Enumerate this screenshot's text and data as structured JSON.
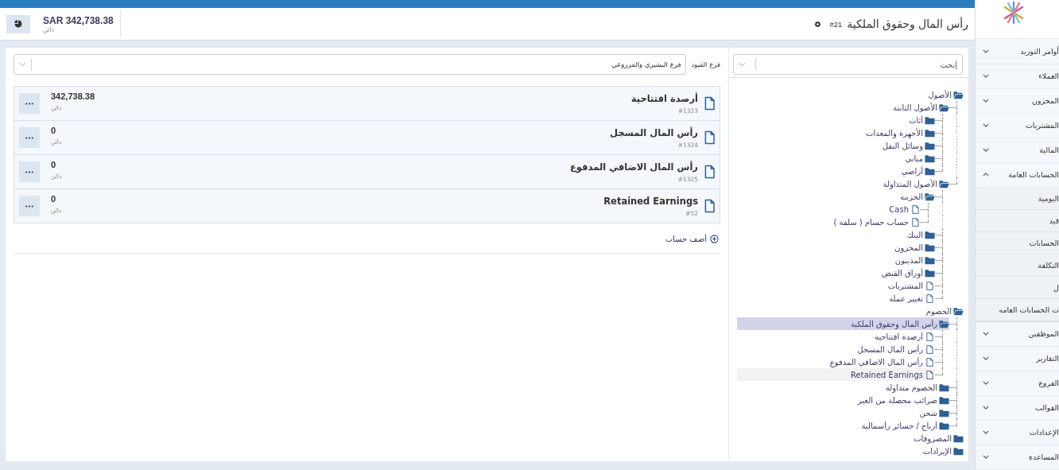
{
  "header": {
    "title": "رأس المال وحقوق الملكية",
    "number": "#21",
    "balance": {
      "amount": "SAR 342,738.38",
      "type": "دائن"
    }
  },
  "sidebar": {
    "items": [
      {
        "label": "أوامر التوريد",
        "expanded": false
      },
      {
        "label": "العملاء",
        "expanded": false
      },
      {
        "label": "المخزون",
        "expanded": false
      },
      {
        "label": "المشتريات",
        "expanded": false
      },
      {
        "label": "المالية",
        "expanded": false
      },
      {
        "label": "الحسابات العامة",
        "expanded": true,
        "children": [
          {
            "label": "اليومية"
          },
          {
            "label": "قيد"
          },
          {
            "label": "الحسابات"
          },
          {
            "label": "التكلفة"
          },
          {
            "label": "ل"
          },
          {
            "label": "ت الحسابات العامه"
          }
        ]
      },
      {
        "label": "الموظفين",
        "expanded": false
      },
      {
        "label": "التقارير",
        "expanded": false
      },
      {
        "label": "الفروع",
        "expanded": false
      },
      {
        "label": "القوالب",
        "expanded": false
      },
      {
        "label": "الإعدادات",
        "expanded": false
      },
      {
        "label": "المساعدة",
        "expanded": false
      }
    ]
  },
  "filter": {
    "label": "فرع القيود",
    "value": "فرع البشيري والمزروعي"
  },
  "accounts": [
    {
      "name": "أرصدة افتتاحية",
      "code": "#1323",
      "amount": "342,738.38",
      "type": "دائن"
    },
    {
      "name": "رأس المال المسجل",
      "code": "#1324",
      "amount": "0",
      "type": "دائن"
    },
    {
      "name": "رأس المال الاضافي المدفوع",
      "code": "#1325",
      "amount": "0",
      "type": "دائن"
    },
    {
      "name": "Retained Earnings",
      "code": "#52",
      "amount": "0",
      "type": "دائن"
    }
  ],
  "add_account": "أضف حساب",
  "tree": {
    "placeholder": "إبحث",
    "nodes": [
      {
        "label": "الأصول",
        "kind": "folder",
        "expanded": true,
        "selected": false,
        "hovered": false,
        "children": [
          {
            "label": "الأصول الثابتة",
            "kind": "folder",
            "expanded": true,
            "selected": false,
            "hovered": false,
            "children": [
              {
                "label": "أثاث",
                "kind": "folder",
                "expanded": false,
                "selected": false,
                "hovered": false
              },
              {
                "label": "الأجهزة والمعدات",
                "kind": "folder",
                "expanded": false,
                "selected": false,
                "hovered": false
              },
              {
                "label": "وسائل النقل",
                "kind": "folder",
                "expanded": false,
                "selected": false,
                "hovered": false
              },
              {
                "label": "مباني",
                "kind": "folder",
                "expanded": false,
                "selected": false,
                "hovered": false
              },
              {
                "label": "أراضي",
                "kind": "folder",
                "expanded": false,
                "selected": false,
                "hovered": false
              }
            ]
          },
          {
            "label": "الأصول المتداولة",
            "kind": "folder",
            "expanded": true,
            "selected": false,
            "hovered": false,
            "children": [
              {
                "label": "الخزينة",
                "kind": "folder",
                "expanded": true,
                "selected": false,
                "hovered": false,
                "children": [
                  {
                    "label": "Cash",
                    "kind": "file",
                    "selected": false,
                    "hovered": false
                  },
                  {
                    "label": "حساب حسام ( سلفة )",
                    "kind": "file",
                    "selected": false,
                    "hovered": false
                  }
                ]
              },
              {
                "label": "البنك",
                "kind": "folder",
                "expanded": false,
                "selected": false,
                "hovered": false
              },
              {
                "label": "المخزون",
                "kind": "folder",
                "expanded": false,
                "selected": false,
                "hovered": false
              },
              {
                "label": "المدينون",
                "kind": "folder",
                "expanded": false,
                "selected": false,
                "hovered": false
              },
              {
                "label": "أوراق القبض",
                "kind": "folder",
                "expanded": false,
                "selected": false,
                "hovered": false
              },
              {
                "label": "المشتريات",
                "kind": "file",
                "selected": false,
                "hovered": false
              },
              {
                "label": "تغيير عملة",
                "kind": "file",
                "selected": false,
                "hovered": false
              }
            ]
          }
        ]
      },
      {
        "label": "الخصوم",
        "kind": "folder",
        "expanded": true,
        "selected": false,
        "hovered": false,
        "children": [
          {
            "label": "رأس المال وحقوق الملكية",
            "kind": "folder",
            "expanded": true,
            "selected": true,
            "hovered": false,
            "children": [
              {
                "label": "أرصدة افتتاحية",
                "kind": "file",
                "selected": false,
                "hovered": false
              },
              {
                "label": "رأس المال المسجل",
                "kind": "file",
                "selected": false,
                "hovered": false
              },
              {
                "label": "رأس المال الاضافي المدفوع",
                "kind": "file",
                "selected": false,
                "hovered": false
              },
              {
                "label": "Retained Earnings",
                "kind": "file",
                "selected": false,
                "hovered": true
              }
            ]
          },
          {
            "label": "الخصوم متداولة",
            "kind": "folder",
            "expanded": false,
            "selected": false,
            "hovered": false
          },
          {
            "label": "ضرائب محصلة من الغير",
            "kind": "folder",
            "expanded": false,
            "selected": false,
            "hovered": false
          },
          {
            "label": "شحن",
            "kind": "folder",
            "expanded": false,
            "selected": false,
            "hovered": false
          },
          {
            "label": "أرباح / خسائر رأسمالية",
            "kind": "folder",
            "expanded": false,
            "selected": false,
            "hovered": false
          }
        ]
      },
      {
        "label": "المصروفات",
        "kind": "folder",
        "expanded": false,
        "selected": false,
        "hovered": false
      },
      {
        "label": "الإيرادات",
        "kind": "folder",
        "expanded": false,
        "selected": false,
        "hovered": false
      }
    ]
  }
}
